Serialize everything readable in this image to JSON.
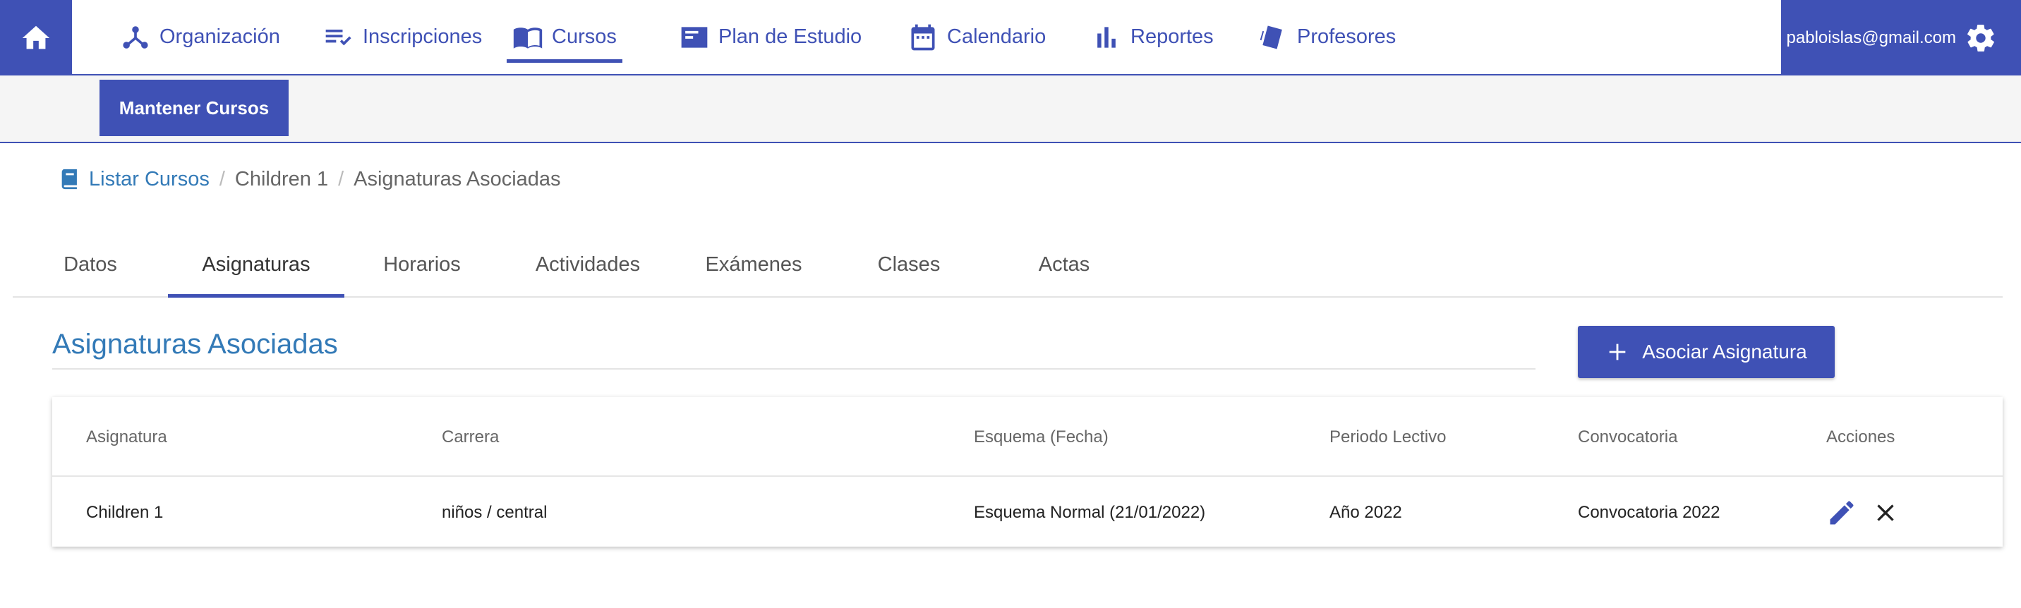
{
  "nav": {
    "items": [
      {
        "label": "Organización",
        "icon": "organization-icon"
      },
      {
        "label": "Inscripciones",
        "icon": "playlist-check-icon"
      },
      {
        "label": "Cursos",
        "icon": "book-open-icon"
      },
      {
        "label": "Plan de Estudio",
        "icon": "study-plan-icon"
      },
      {
        "label": "Calendario",
        "icon": "calendar-icon"
      },
      {
        "label": "Reportes",
        "icon": "bar-chart-icon"
      },
      {
        "label": "Profesores",
        "icon": "teacher-icon"
      }
    ],
    "active": "Cursos",
    "user_email": "pabloislas@gmail.com"
  },
  "subnav": {
    "button_label": "Mantener Cursos"
  },
  "breadcrumb": {
    "items": [
      "Listar Cursos",
      "Children 1",
      "Asignaturas Asociadas"
    ],
    "separator": "/"
  },
  "tabs": [
    "Datos",
    "Asignaturas",
    "Horarios",
    "Actividades",
    "Exámenes",
    "Clases",
    "Actas"
  ],
  "active_tab": "Asignaturas",
  "section": {
    "title": "Asignaturas Asociadas",
    "add_button_label": "Asociar Asignatura"
  },
  "table": {
    "headers": [
      "Asignatura",
      "Carrera",
      "Esquema (Fecha)",
      "Periodo Lectivo",
      "Convocatoria",
      "Acciones"
    ],
    "rows": [
      {
        "asignatura": "Children 1",
        "carrera": "niños / central",
        "esquema": "Esquema Normal (21/01/2022)",
        "periodo": "Año 2022",
        "convocatoria": "Convocatoria 2022"
      }
    ]
  },
  "colors": {
    "primary": "#3f51b5",
    "link": "#337ab7"
  }
}
